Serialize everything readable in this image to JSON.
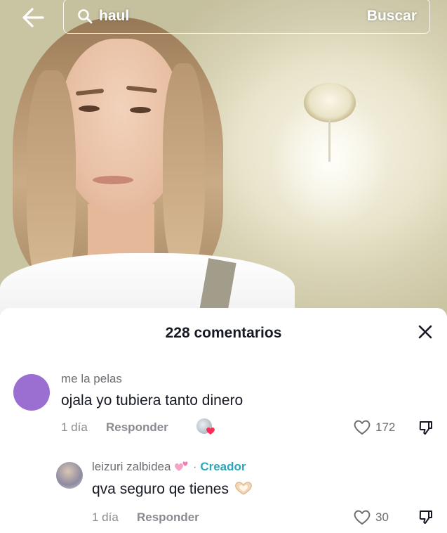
{
  "search": {
    "query": "haul",
    "action_label": "Buscar"
  },
  "comments_panel": {
    "title": "228 comentarios"
  },
  "comments": [
    {
      "username": "me la pelas",
      "text": "ojala yo tubiera tanto dinero",
      "time": "1 día",
      "reply_label": "Responder",
      "likes": "172",
      "avatar_color": "#9b6fd2"
    },
    {
      "username": "leizuri zalbidea",
      "separator": "·",
      "creator_badge": "Creador",
      "text": "qva seguro qe tienes",
      "time": "1 día",
      "reply_label": "Responder",
      "likes": "30"
    }
  ],
  "icons": {
    "back": "arrow-left-icon",
    "search": "magnifier-icon",
    "close": "close-x-icon",
    "like": "heart-outline-icon",
    "dislike": "thumbs-down-icon"
  },
  "colors": {
    "creator": "#2ea6b6",
    "text": "#161823",
    "muted": "#8a8b91"
  }
}
